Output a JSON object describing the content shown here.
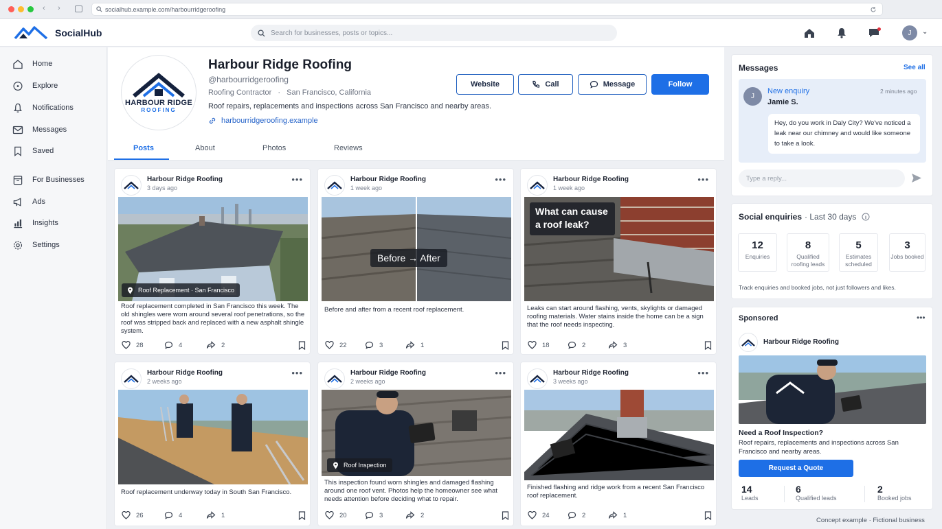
{
  "browser": {
    "url": "socialhub.example.com/harbourridgeroofing"
  },
  "app": {
    "name": "SocialHub",
    "search_placeholder": "Search for businesses, posts or topics...",
    "avatar_initial": "J"
  },
  "sidebar": {
    "items": [
      {
        "label": "Home",
        "icon": "home-icon"
      },
      {
        "label": "Explore",
        "icon": "compass-icon"
      },
      {
        "label": "Notifications",
        "icon": "bell-icon"
      },
      {
        "label": "Messages",
        "icon": "mail-icon"
      },
      {
        "label": "Saved",
        "icon": "bookmark-icon"
      },
      {
        "label": "For Businesses",
        "icon": "building-icon"
      },
      {
        "label": "Ads",
        "icon": "megaphone-icon"
      },
      {
        "label": "Insights",
        "icon": "chart-icon"
      },
      {
        "label": "Settings",
        "icon": "gear-icon"
      }
    ]
  },
  "profile": {
    "logo_line1": "HARBOUR RIDGE",
    "logo_line2": "ROOFING",
    "name": "Harbour Ridge Roofing",
    "handle": "@harbourridgeroofing",
    "category": "Roofing Contractor",
    "location": "San Francisco, California",
    "description": "Roof repairs, replacements and inspections across San Francisco and nearby areas.",
    "website": "harbourridgeroofing.example",
    "buttons": {
      "website": "Website",
      "call": "Call",
      "message": "Message",
      "follow": "Follow"
    },
    "tabs": [
      "Posts",
      "About",
      "Photos",
      "Reviews"
    ]
  },
  "posts": [
    {
      "author": "Harbour Ridge Roofing",
      "time": "3 days ago",
      "tag": "Roof Replacement · San Francisco",
      "caption": "Roof replacement completed in San Francisco this week. The old shingles were worn around several roof penetrations, so the roof was stripped back and replaced with a new asphalt shingle system.",
      "likes": "28",
      "comments": "4",
      "shares": "2"
    },
    {
      "author": "Harbour Ridge Roofing",
      "time": "1 week ago",
      "overlay": "Before → After",
      "caption": "Before and after from a recent roof replacement.",
      "likes": "22",
      "comments": "3",
      "shares": "1"
    },
    {
      "author": "Harbour Ridge Roofing",
      "time": "1 week ago",
      "overlay": "What can cause a roof leak?",
      "caption": "Leaks can start around flashing, vents, skylights or damaged roofing materials. Water stains inside the home can be a sign that the roof needs inspecting.",
      "likes": "18",
      "comments": "2",
      "shares": "3"
    },
    {
      "author": "Harbour Ridge Roofing",
      "time": "2 weeks ago",
      "caption": "Roof replacement underway today in South San Francisco.",
      "likes": "26",
      "comments": "4",
      "shares": "1"
    },
    {
      "author": "Harbour Ridge Roofing",
      "time": "2 weeks ago",
      "tag": "Roof Inspection",
      "caption": "This inspection found worn shingles and damaged flashing around one roof vent. Photos help the homeowner see what needs attention before deciding what to repair.",
      "likes": "20",
      "comments": "3",
      "shares": "2"
    },
    {
      "author": "Harbour Ridge Roofing",
      "time": "3 weeks ago",
      "caption": "Finished flashing and ridge work from a recent San Francisco roof replacement.",
      "likes": "24",
      "comments": "2",
      "shares": "1"
    }
  ],
  "messages": {
    "title": "Messages",
    "see_all": "See all",
    "sender_initial": "J",
    "label": "New enquiry",
    "time": "2 minutes ago",
    "sender": "Jamie S.",
    "body": "Hey, do you work in Daly City? We've noticed a leak near our chimney and would like someone to take a look.",
    "reply_placeholder": "Type a reply..."
  },
  "enquiries": {
    "title": "Social enquiries",
    "period": "· Last 30 days",
    "stats": [
      {
        "value": "12",
        "label": "Enquiries"
      },
      {
        "value": "8",
        "label": "Qualified roofing leads"
      },
      {
        "value": "5",
        "label": "Estimates scheduled"
      },
      {
        "value": "3",
        "label": "Jobs booked"
      }
    ],
    "note": "Track enquiries and booked jobs, not just followers and likes."
  },
  "sponsored": {
    "title": "Sponsored",
    "author": "Harbour Ridge Roofing",
    "headline": "Need a Roof Inspection?",
    "text": "Roof repairs, replacements and inspections across San Francisco and nearby areas.",
    "cta": "Request a Quote",
    "stats": [
      {
        "value": "14",
        "label": "Leads"
      },
      {
        "value": "6",
        "label": "Qualified leads"
      },
      {
        "value": "2",
        "label": "Booked jobs"
      }
    ]
  },
  "footer": {
    "note": "Concept example · Fictional business"
  },
  "colors": {
    "accent": "#1e6fe6",
    "brand": "#14213d"
  }
}
